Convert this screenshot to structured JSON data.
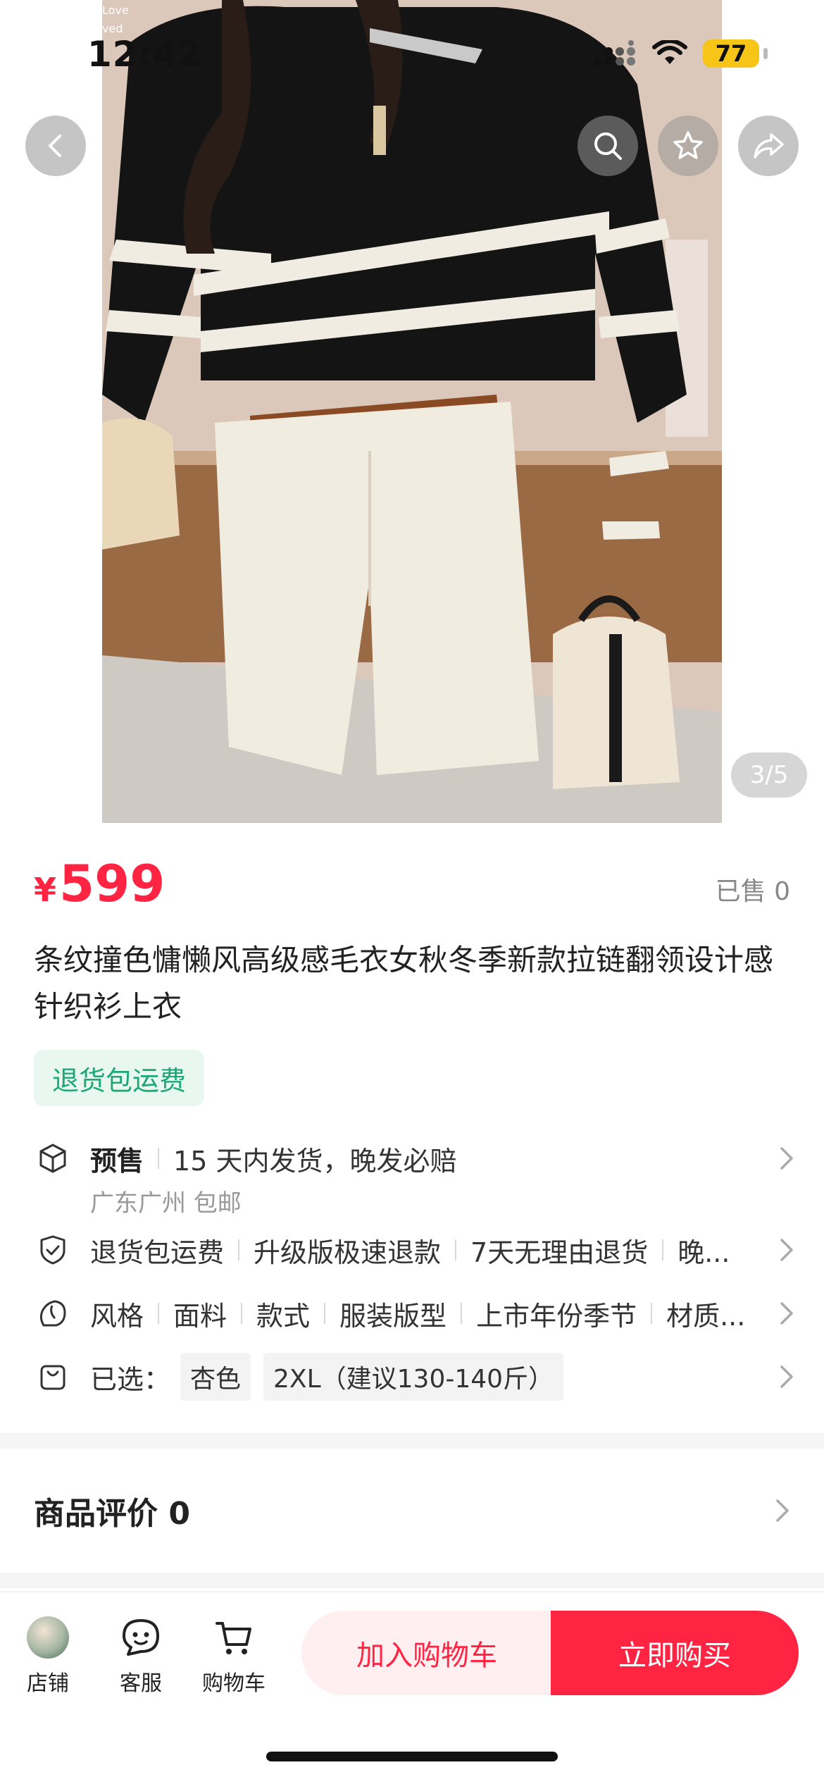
{
  "status": {
    "time": "12:42",
    "battery": "77"
  },
  "gallery": {
    "counter": "3/5",
    "watermark_line1": "Love",
    "watermark_line2": "ved"
  },
  "product": {
    "currency": "¥",
    "price": "599",
    "sold": "已售 0",
    "title": "条纹撞色慵懒风高级感毛衣女秋冬季新款拉链翻领设计感针织衫上衣",
    "tag": "退货包运费"
  },
  "rows": {
    "shipping": {
      "label": "预售",
      "detail": "15 天内发货，晚发必赔",
      "sub": "广东广州 包邮"
    },
    "services": [
      "退货包运费",
      "升级版极速退款",
      "7天无理由退货",
      "晚..."
    ],
    "params": [
      "风格",
      "面料",
      "款式",
      "服装版型",
      "上市年份季节",
      "材质..."
    ],
    "selected": {
      "label": "已选：",
      "options": [
        "杏色",
        "2XL（建议130-140斤）"
      ]
    }
  },
  "reviews": {
    "title": "商品评价 0"
  },
  "bottom_bar": {
    "store": "店铺",
    "service": "客服",
    "cart": "购物车",
    "add_to_cart": "加入购物车",
    "buy_now": "立即购买"
  },
  "colors": {
    "accent": "#ff2442",
    "tag_green": "#1ea777",
    "battery": "#f6c518"
  },
  "icons": [
    "back-icon",
    "search-icon",
    "star-icon",
    "share-icon",
    "package-icon",
    "shield-icon",
    "style-icon",
    "bag-icon",
    "chevron-right-icon",
    "chat-icon",
    "cart-icon"
  ]
}
